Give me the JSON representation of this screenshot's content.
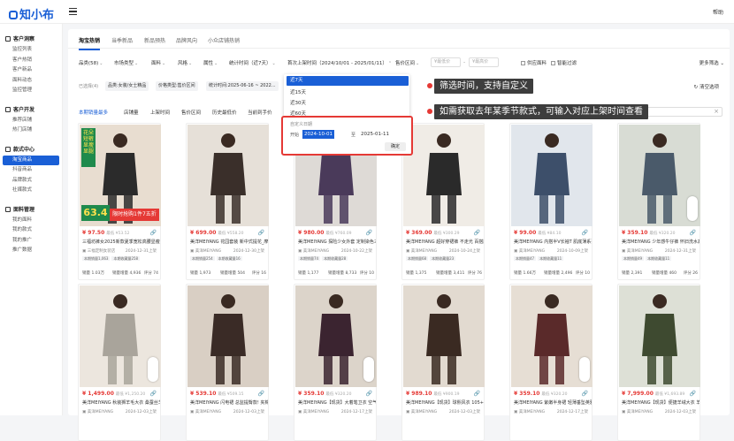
{
  "app": {
    "logo": "知小布",
    "help": "帮助"
  },
  "sidebar": [
    {
      "group": "客户洞察",
      "items": [
        "监控列表",
        "客户热销",
        "客户新品",
        "面料动态",
        "监控管理"
      ]
    },
    {
      "group": "客户开发",
      "items": [
        "推荐店铺",
        "热门店铺"
      ]
    },
    {
      "group": "款式中心",
      "items": [
        "淘宝商品",
        "抖音商品",
        "品牌款式",
        "社媒款式"
      ],
      "active": "淘宝商品"
    },
    {
      "group": "面料管理",
      "items": [
        "我的面料",
        "我的款式",
        "我的推广",
        "推广数据"
      ]
    }
  ],
  "tabs": [
    "淘宝热销",
    "当季新品",
    "新品预热",
    "品牌风向",
    "小众店铺热销"
  ],
  "filters": {
    "items": [
      "品类(58)",
      "市场类型",
      "面料",
      "风格",
      "属性",
      "统计时间（近7天）",
      "首次上架时间（2024/10/01 - 2025/01/11）",
      "售价区间"
    ],
    "price_min_placeholder": "¥最低价",
    "price_max_placeholder": "¥最高价",
    "checkboxes": [
      "供应面料",
      "智能过滤"
    ],
    "more": "更多筛选"
  },
  "selected": {
    "label": "已选择(4)",
    "tags": [
      "品类:女装/女士精品",
      "价格类型:售价区间",
      "统计时间:2025-06-16 ~ 2022..."
    ],
    "clear": "清空选项"
  },
  "sort": [
    "本期销量最多",
    "店铺量",
    "上架时间",
    "售价区间",
    "历史最低价",
    "当前到手价"
  ],
  "dropdown": {
    "options": [
      "近7天",
      "近15天",
      "近30天",
      "近60天"
    ],
    "selected": "近7天"
  },
  "date_range": {
    "title": "自定义日期",
    "start_label": "开始",
    "start": "2024-10-01",
    "end_label": "至",
    "end": "2025-01-11",
    "ok": "确定"
  },
  "callouts": [
    "筛选时间，支持自定义",
    "如需获取去年某季节款式，可输入对应上架时间查看"
  ],
  "products": [
    {
      "price": "¥ 97.50",
      "orig": "最低 ¥53.52",
      "title": "三福坊裤女2025新款夏季宽松高腰显瘦休闲短裤",
      "shop": "三福定制女装店",
      "date": "2024-12-31上架",
      "tags": [
        "本期销量1,063",
        "本期收藏量258"
      ],
      "sales": "1.03万",
      "inc": "4,936",
      "score": "74",
      "promo_price": "63.4",
      "promo_text": "限时抢购1件7五折",
      "vtext": "花朵短裤显瘦显腿"
    },
    {
      "price": "¥ 699.00",
      "orig": "最低 ¥558.20",
      "title": "美洋MEIYANG 花园套装 新中式提花_摩哮V领...",
      "shop": "美洋MEIYANG",
      "date": "2024-12-30上架",
      "tags": [
        "本期销量254",
        "本期收藏量16"
      ],
      "sales": "1,973",
      "inc": "504",
      "score": "16"
    },
    {
      "price": "¥ 980.00",
      "orig": "最低 ¥760.09",
      "title": "美洋MEIYANG 探险少女外套 定制染色三防...",
      "shop": "美洋MEIYANG",
      "date": "2024-10-22上架",
      "tags": [
        "本期销量74",
        "本期收藏量28"
      ],
      "sales": "1,177",
      "inc": "8,733",
      "score": "10"
    },
    {
      "price": "¥ 369.00",
      "orig": "最低 ¥300.29",
      "title": "美洋MEIYANG 超好穿裙裤 不走光 百搭腰带...",
      "shop": "美洋MEIYANG",
      "date": "2024-10-24上架",
      "tags": [
        "本期销量68",
        "本期收藏量23"
      ],
      "sales": "1,375",
      "inc": "3,411",
      "score": "76"
    },
    {
      "price": "¥ 99.00",
      "orig": "最低 ¥84.10",
      "title": "美洋MEIYANG 内搭半V长袖T 肌底薄系列-U...",
      "shop": "美洋MEIYANG",
      "date": "2024-10-09上架",
      "tags": [
        "本期销量47",
        "本期收藏量11"
      ],
      "sales": "1.66万",
      "inc": "2,496",
      "score": "10"
    },
    {
      "price": "¥ 359.10",
      "orig": "最低 ¥320.20",
      "title": "美洋MEIYANG 少年感牛仔裤 怀旧洗水高腰...",
      "shop": "美洋MEIYANG",
      "date": "2024-12-31上架",
      "tags": [
        "本期销量49",
        "本期收藏量11"
      ],
      "sales": "2,391",
      "inc": "460",
      "score": "26"
    },
    {
      "price": "¥ 1,499.00",
      "orig": "最低 ¥1,250.20",
      "title": "美洋MEIYANG 秋装狮羊毛大衣 桑蚕丝羊毛...",
      "shop": "美洋MEIYANG",
      "date": "2024-12-03上架",
      "tags": [],
      "sales": "",
      "inc": "",
      "score": ""
    },
    {
      "price": "¥ 539.10",
      "orig": "最低 ¥509.15",
      "title": "美洋MEIYANG 闪电裙 总监提臀款! 夹棉喇...",
      "shop": "美洋MEIYANG",
      "date": "2024-12-03上架",
      "tags": [],
      "sales": "",
      "inc": "",
      "score": ""
    },
    {
      "price": "¥ 359.10",
      "orig": "最低 ¥320.20",
      "title": "美洋MEIYANG【现货】大着笔卫衣 空气层...",
      "shop": "美洋MEIYANG",
      "date": "2024-12-17上架",
      "tags": [],
      "sales": "",
      "inc": "",
      "score": ""
    },
    {
      "price": "¥ 989.10",
      "orig": "最低 ¥900.19",
      "title": "美洋MEIYANG【现货】球熙风衣 105+变...",
      "shop": "美洋MEIYANG",
      "date": "2024-12-03上架",
      "tags": [],
      "sales": "",
      "inc": "",
      "score": ""
    },
    {
      "price": "¥ 359.10",
      "orig": "最低 ¥320.20",
      "title": "美洋MEIYANG 紫嫩半身裙 轻薄垂坠英雅郊...",
      "shop": "美洋MEIYANG",
      "date": "2024-12-17上架",
      "tags": [],
      "sales": "",
      "inc": "",
      "score": ""
    },
    {
      "price": "¥ 7,999.00",
      "orig": "最低 ¥1,693.89",
      "title": "美洋MEIYANG【现货】便捷羊绒大衣 羊绒...",
      "shop": "美洋MEIYANG",
      "date": "2024-12-03上架",
      "tags": [],
      "sales": "",
      "inc": "",
      "score": ""
    }
  ],
  "stat_labels": {
    "sales": "销量",
    "inc": "销量增量",
    "score": "评分"
  }
}
